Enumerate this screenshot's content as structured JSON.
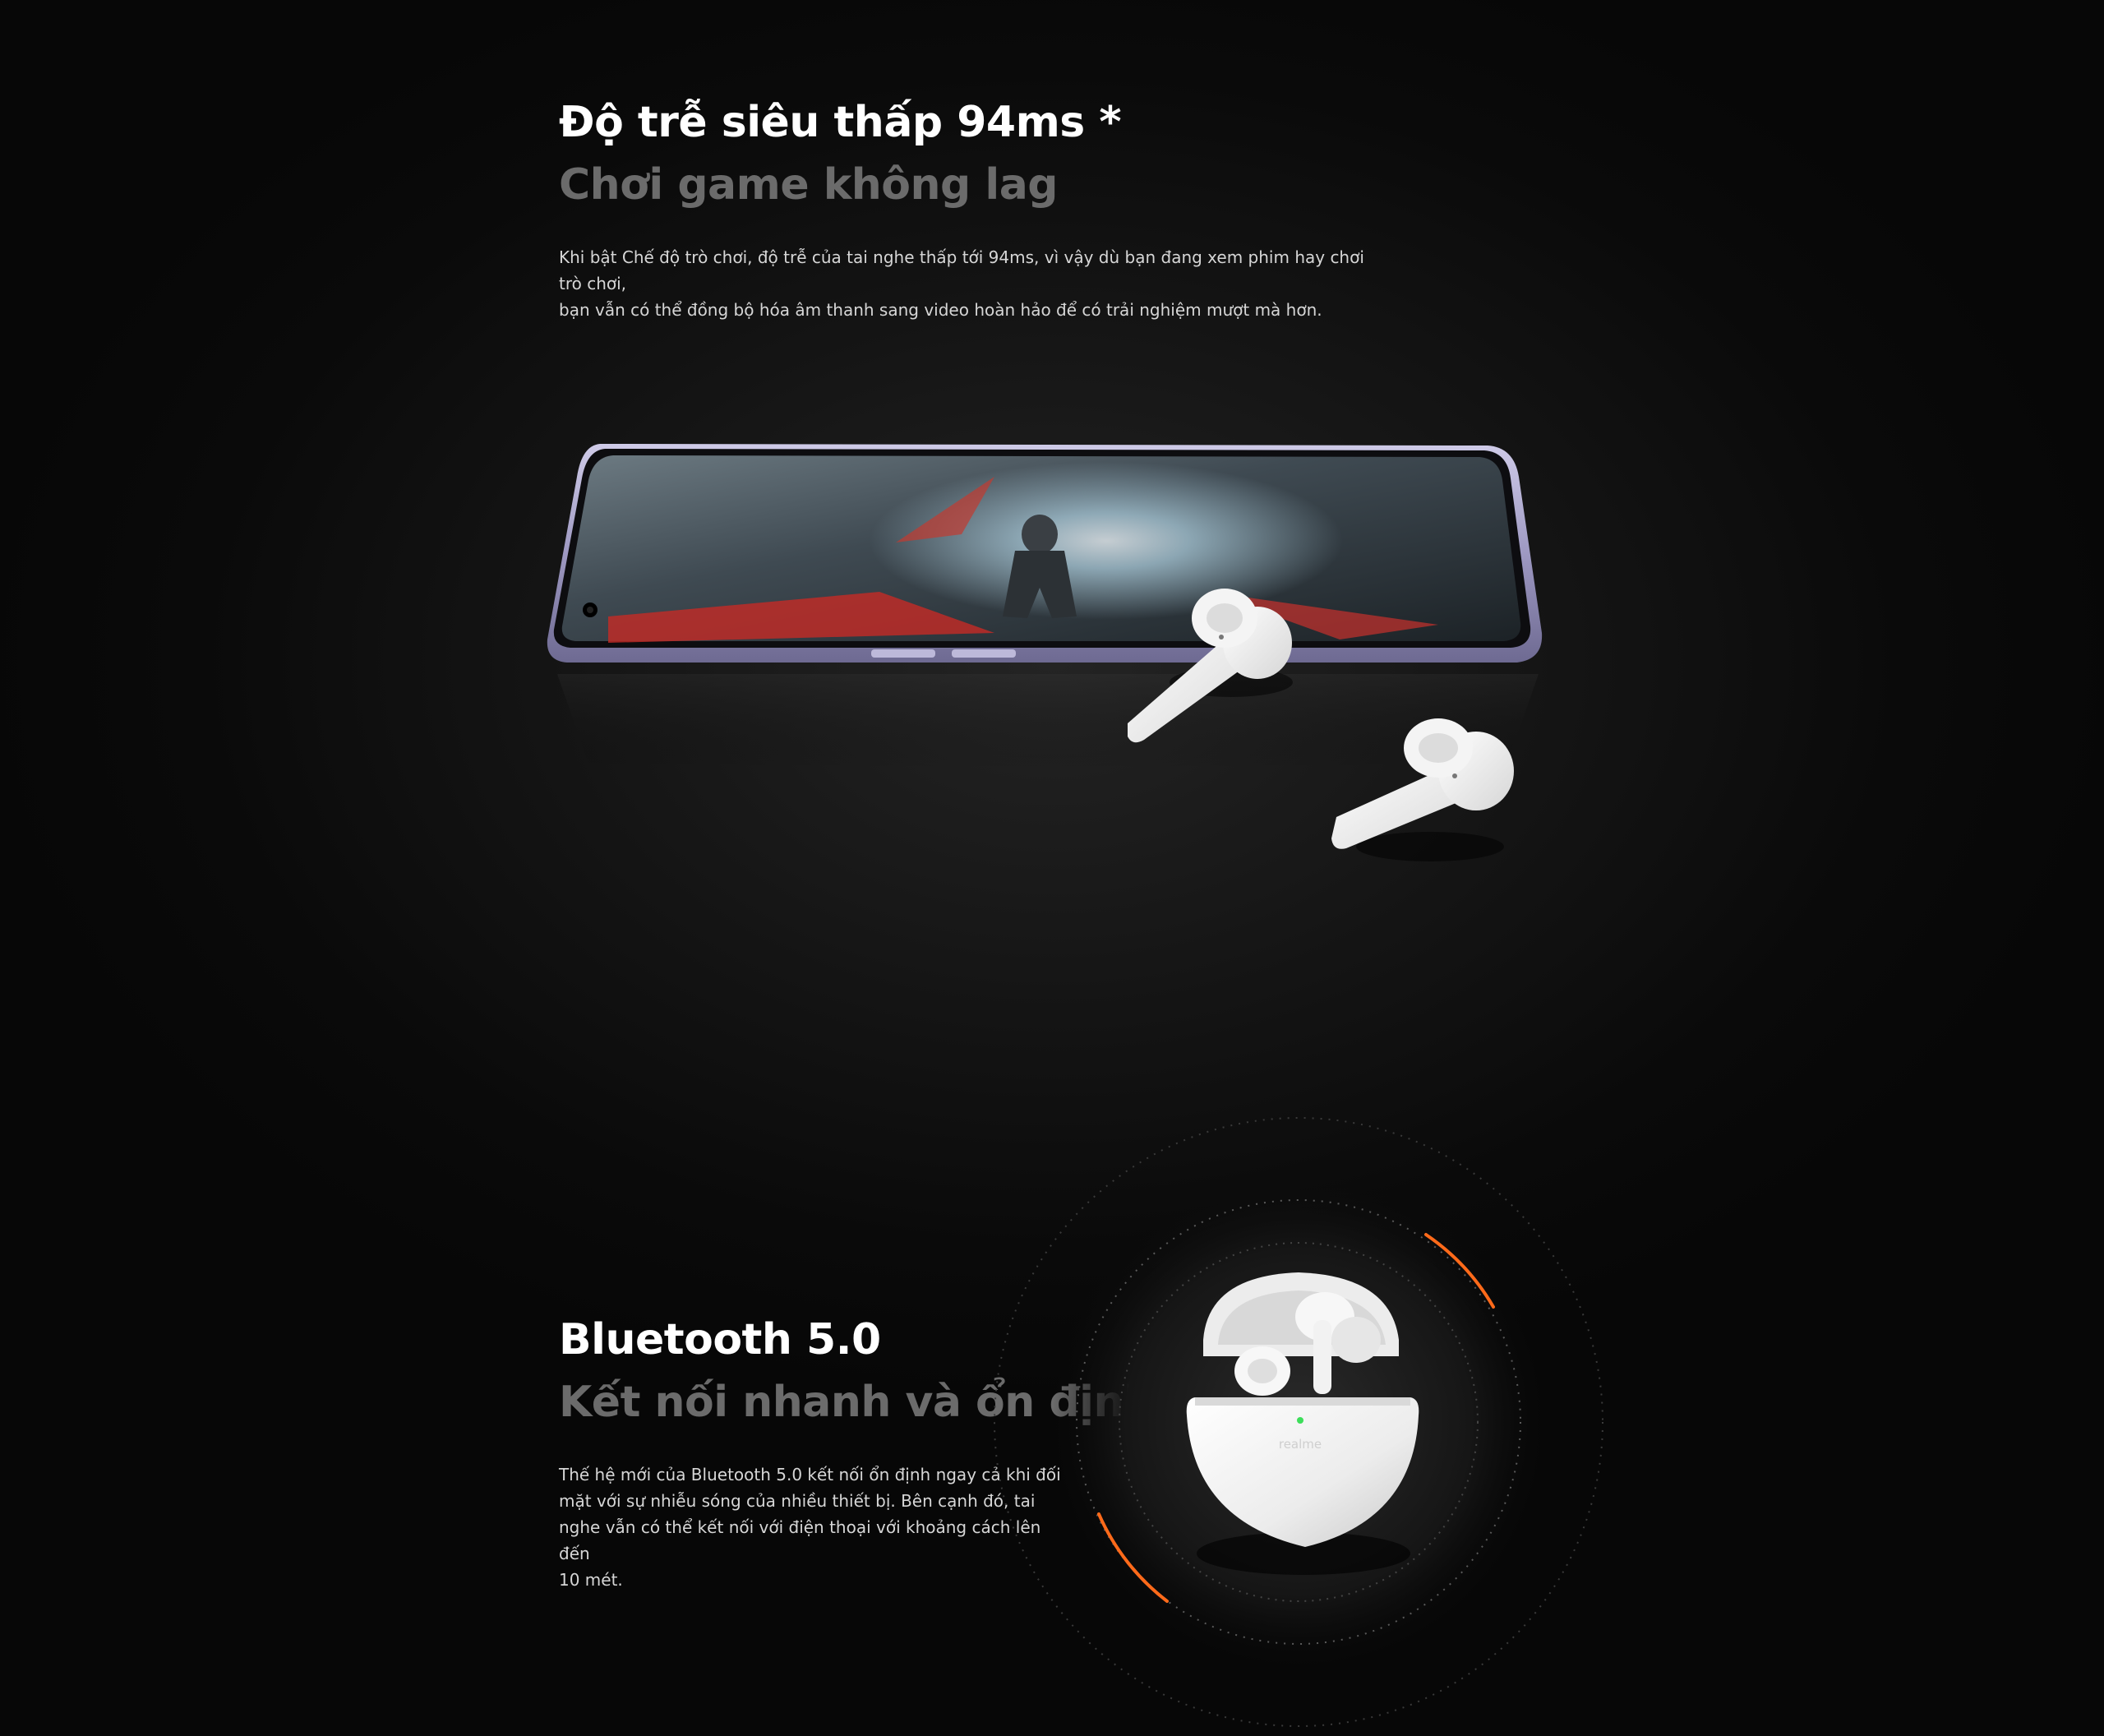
{
  "latency_section": {
    "title": "Độ trễ siêu thấp 94ms *",
    "subtitle": "Chơi game không lag",
    "description_line1": "Khi bật Chế độ trò chơi, độ trễ của tai nghe thấp tới 94ms, vì vậy dù bạn đang xem phim hay chơi trò chơi,",
    "description_line2": "bạn vẫn có thể đồng bộ hóa âm thanh sang video hoàn hảo để có trải nghiệm mượt mà hơn."
  },
  "bluetooth_section": {
    "title": "Bluetooth 5.0",
    "subtitle": "Kết nối nhanh và ổn định",
    "description_line1": "Thế hệ mới của Bluetooth 5.0 kết nối ổn định ngay cả khi đối",
    "description_line2": "mặt với sự nhiễu sóng của nhiều thiết bị. Bên cạnh đó, tai",
    "description_line3": "nghe vẫn có thể kết nối với điện thoại với khoảng cách lên đến",
    "description_line4": "10 mét.",
    "case_logo": "realme"
  },
  "colors": {
    "background": "#0b0b0b",
    "title": "#ffffff",
    "subtitle": "#6b6b6b",
    "body": "#d6d6d6",
    "accent_orange": "#ff6a1a",
    "phone_frame": "#a7a3c9"
  },
  "icons": {
    "phone_image": "phone-game-image",
    "earbuds_image": "earbuds-image",
    "case_image": "charging-case-image"
  }
}
